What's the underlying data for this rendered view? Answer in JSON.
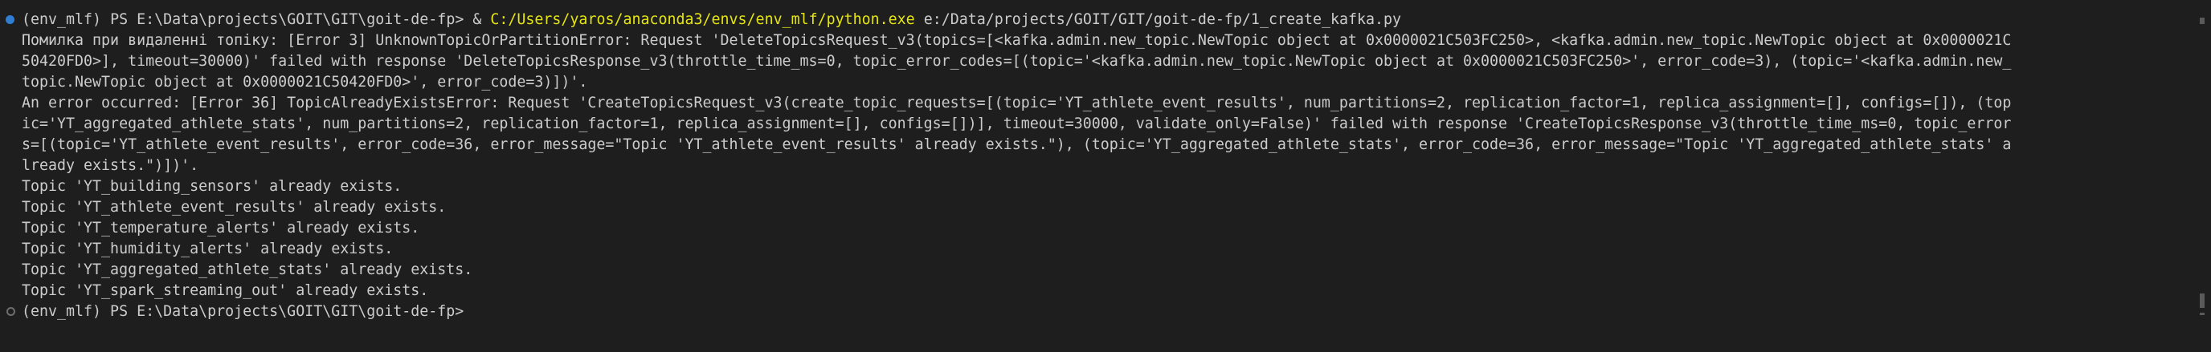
{
  "terminal": {
    "prompt1": {
      "env": "(env_mlf)",
      "cwd": "PS E:\\Data\\projects\\GOIT\\GIT\\goit-de-fp>",
      "operator": "&",
      "exe_path": "C:/Users/yaros/anaconda3/envs/env_mlf/python.exe",
      "script_arg": "e:/Data/projects/GOIT/GIT/goit-de-fp/1_create_kafka.py"
    },
    "output": [
      "Помилка при видаленні топіку: [Error 3] UnknownTopicOrPartitionError: Request 'DeleteTopicsRequest_v3(topics=[<kafka.admin.new_topic.NewTopic object at 0x0000021C503FC250>, <kafka.admin.new_topic.NewTopic object at 0x0000021C",
      "50420FD0>], timeout=30000)' failed with response 'DeleteTopicsResponse_v3(throttle_time_ms=0, topic_error_codes=[(topic='<kafka.admin.new_topic.NewTopic object at 0x0000021C503FC250>', error_code=3), (topic='<kafka.admin.new_",
      "topic.NewTopic object at 0x0000021C50420FD0>', error_code=3)])'.",
      "An error occurred: [Error 36] TopicAlreadyExistsError: Request 'CreateTopicsRequest_v3(create_topic_requests=[(topic='YT_athlete_event_results', num_partitions=2, replication_factor=1, replica_assignment=[], configs=[]), (top",
      "ic='YT_aggregated_athlete_stats', num_partitions=2, replication_factor=1, replica_assignment=[], configs=[])], timeout=30000, validate_only=False)' failed with response 'CreateTopicsResponse_v3(throttle_time_ms=0, topic_error",
      "s=[(topic='YT_athlete_event_results', error_code=36, error_message=\"Topic 'YT_athlete_event_results' already exists.\"), (topic='YT_aggregated_athlete_stats', error_code=36, error_message=\"Topic 'YT_aggregated_athlete_stats' a",
      "lready exists.\")])'.",
      "Topic 'YT_building_sensors' already exists.",
      "Topic 'YT_athlete_event_results' already exists.",
      "Topic 'YT_temperature_alerts' already exists.",
      "Topic 'YT_humidity_alerts' already exists.",
      "Topic 'YT_aggregated_athlete_stats' already exists.",
      "Topic 'YT_spark_streaming_out' already exists."
    ],
    "prompt2": "(env_mlf) PS E:\\Data\\projects\\GOIT\\GIT\\goit-de-fp>"
  }
}
